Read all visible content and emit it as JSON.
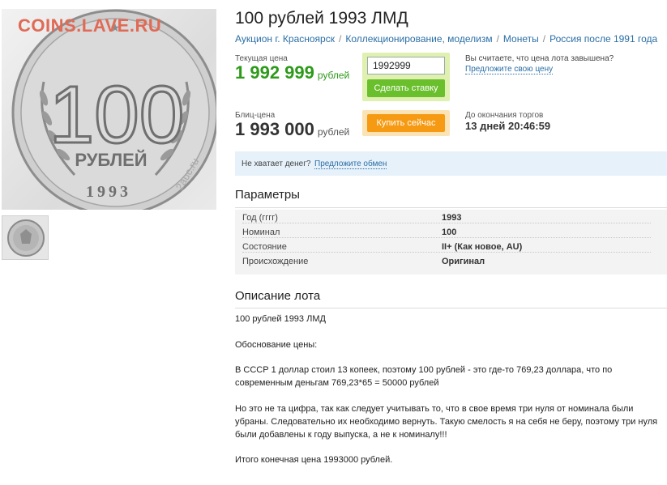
{
  "watermark": "COINS.LAVE.RU",
  "photo": {
    "coin_denomination": "100",
    "coin_unit": "РУБЛЕЙ",
    "coin_year": "1993",
    "site_mark": "2auc.ru"
  },
  "lot": {
    "title": "100 рублей 1993 ЛМД"
  },
  "breadcrumb": [
    "Аукцион г. Красноярск",
    "Коллекционирование, моделизм",
    "Монеты",
    "Россия после 1991 года"
  ],
  "current_price": {
    "label": "Текущая цена",
    "value": "1 992 999",
    "currency": "рублей"
  },
  "bid": {
    "input_value": "1992999",
    "button_label": "Сделать ставку"
  },
  "overprice": {
    "question": "Вы считаете, что цена лота завышена?",
    "link": "Предложите свою цену"
  },
  "blitz_price": {
    "label": "Блиц-цена",
    "value": "1 993 000",
    "currency": "рублей"
  },
  "buy_now": {
    "button_label": "Купить сейчас"
  },
  "auction_end": {
    "label": "До окончания торгов",
    "value": "13 дней 20:46:59"
  },
  "exchange": {
    "question": "Не хватает денег?",
    "link": "Предложите обмен"
  },
  "params": {
    "heading": "Параметры",
    "rows": [
      {
        "key": "Год (гггг)",
        "value": "1993"
      },
      {
        "key": "Номинал",
        "value": "100"
      },
      {
        "key": "Состояние",
        "value": "II+ (Как новое, AU)"
      },
      {
        "key": "Происхождение",
        "value": "Оригинал"
      }
    ]
  },
  "description": {
    "heading": "Описание лота",
    "paragraphs": [
      "100 рублей 1993 ЛМД",
      "Обоснование цены:",
      "В СССР 1 доллар стоил 13 копеек, поэтому 100 рублей - это где-то 769,23 доллара, что по современным деньгам 769,23*65 = 50000 рублей",
      "Но это не та цифра, так как следует учитывать то, что в свое время три нуля от номинала были убраны. Следовательно их необходимо вернуть. Такую смелость я на себя не беру, поэтому три нуля были добавлены к году выпуска, а не к номиналу!!!",
      "Итого конечная цена 1993000 рублей."
    ]
  },
  "colors": {
    "price_green": "#2d9a1a",
    "link_blue": "#2a6ea5",
    "bid_button": "#6abf2d",
    "buy_button": "#f59a12",
    "watermark": "#e06a55"
  }
}
